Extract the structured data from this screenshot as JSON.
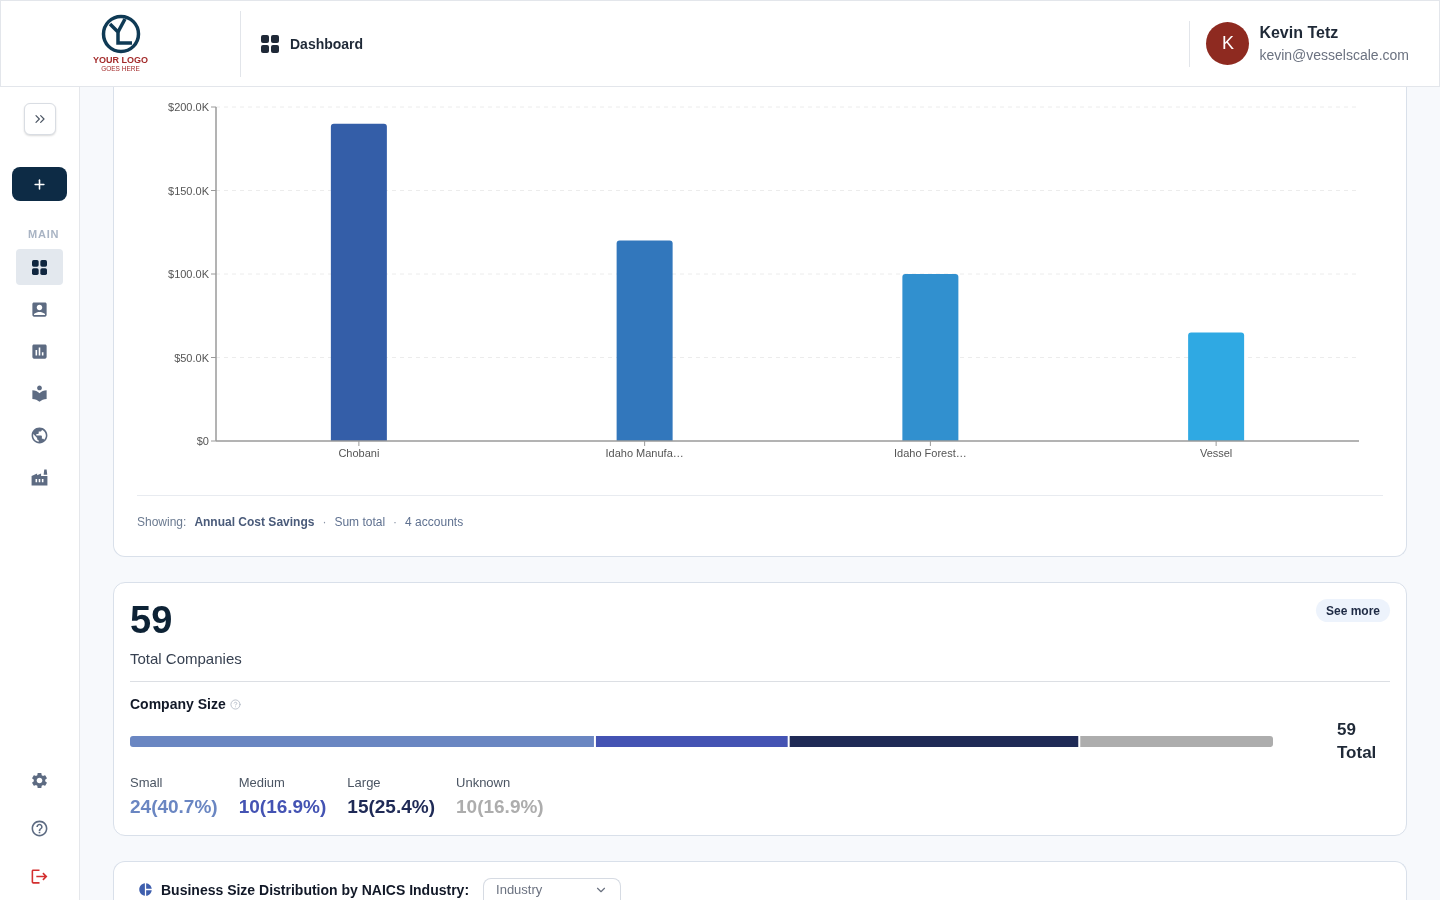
{
  "header": {
    "logo": {
      "name": "YOUR LOGO",
      "tagline": "GOES HERE"
    },
    "page_title": "Dashboard",
    "user": {
      "initial": "K",
      "name": "Kevin Tetz",
      "email": "kevin@vesselscale.com"
    }
  },
  "sidebar": {
    "section_label": "MAIN",
    "items": [
      {
        "kind": "dashboard",
        "selected": true
      },
      {
        "kind": "contacts",
        "selected": false
      },
      {
        "kind": "reports",
        "selected": false
      },
      {
        "kind": "learning",
        "selected": false
      },
      {
        "kind": "globe",
        "selected": false
      },
      {
        "kind": "factory",
        "selected": false
      }
    ],
    "footer_items": [
      {
        "kind": "settings"
      },
      {
        "kind": "help"
      },
      {
        "kind": "logout"
      }
    ]
  },
  "savings_chart": {
    "chart_data": {
      "type": "bar",
      "grid": true,
      "categories": [
        "Chobani",
        "Idaho Manufa…",
        "Idaho Forest…",
        "Vessel"
      ],
      "values": [
        190000,
        120000,
        100000,
        65000
      ],
      "ylim": [
        0,
        200000
      ],
      "yticks": [
        {
          "value": 0,
          "label": "$0"
        },
        {
          "value": 50000,
          "label": "$50.0K"
        },
        {
          "value": 100000,
          "label": "$100.0K"
        },
        {
          "value": 150000,
          "label": "$150.0K"
        },
        {
          "value": 200000,
          "label": "$200.0K"
        }
      ]
    },
    "footer": [
      {
        "kind": "label",
        "text": "Showing:"
      },
      {
        "kind": "metric",
        "text": "Annual Cost Savings"
      },
      {
        "kind": "separator",
        "text": "·"
      },
      {
        "kind": "detail",
        "text": "Sum total"
      },
      {
        "kind": "separator",
        "text": "·"
      },
      {
        "kind": "detail",
        "text": "4 accounts"
      }
    ]
  },
  "companies_card": {
    "total": "59",
    "total_label": "Total Companies",
    "see_more": "See more",
    "size_title": "Company Size",
    "segments": [
      {
        "label": "Small",
        "value": "24(40.7%)",
        "color": "#6a86c2"
      },
      {
        "label": "Medium",
        "value": "10(16.9%)",
        "color": "#4453b3"
      },
      {
        "label": "Large",
        "value": "15(25.4%)",
        "color": "#1f2a56"
      },
      {
        "label": "Unknown",
        "value": "10(16.9%)",
        "color": "#adadad"
      }
    ],
    "bar_total": "59",
    "bar_total_label": "Total"
  },
  "industry_card": {
    "title": "Business Size Distribution by NAICS Industry:",
    "filter": {
      "placeholder": "Industry"
    }
  }
}
